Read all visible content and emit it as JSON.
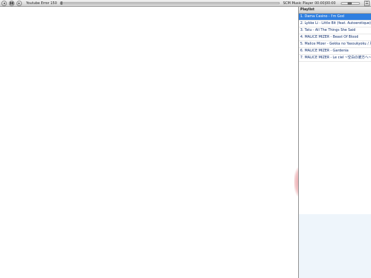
{
  "player": {
    "prev_label": "◂",
    "play_label": "▮▮",
    "next_label": "▸",
    "track_title": "Youtube Error 150",
    "brand": "SCM Music Player",
    "time": "00:00|00:00",
    "progress": 0,
    "volume": 0.45,
    "playlist_toggle_label": "☰"
  },
  "playlist": {
    "title": "Playlist",
    "items": [
      "1. Dama Casino - I'm God",
      "2. Lykke Li - Little Bit (feat. Autoerotique) (R",
      "3. Tatu - All The Things She Said",
      "4. MALICE MIZER - Beast Of Blood",
      "5. Malice Mizer - Gekka no Yasoukyoku / 月",
      "6. MALICE MIZER - Gardenia",
      "7. MALICE MIZER - Le ciel ~空白の彼方へ~"
    ],
    "active_index": 0
  },
  "colors": {
    "accent": "#2f7fe0",
    "panel_bg": "#eef5fb"
  }
}
